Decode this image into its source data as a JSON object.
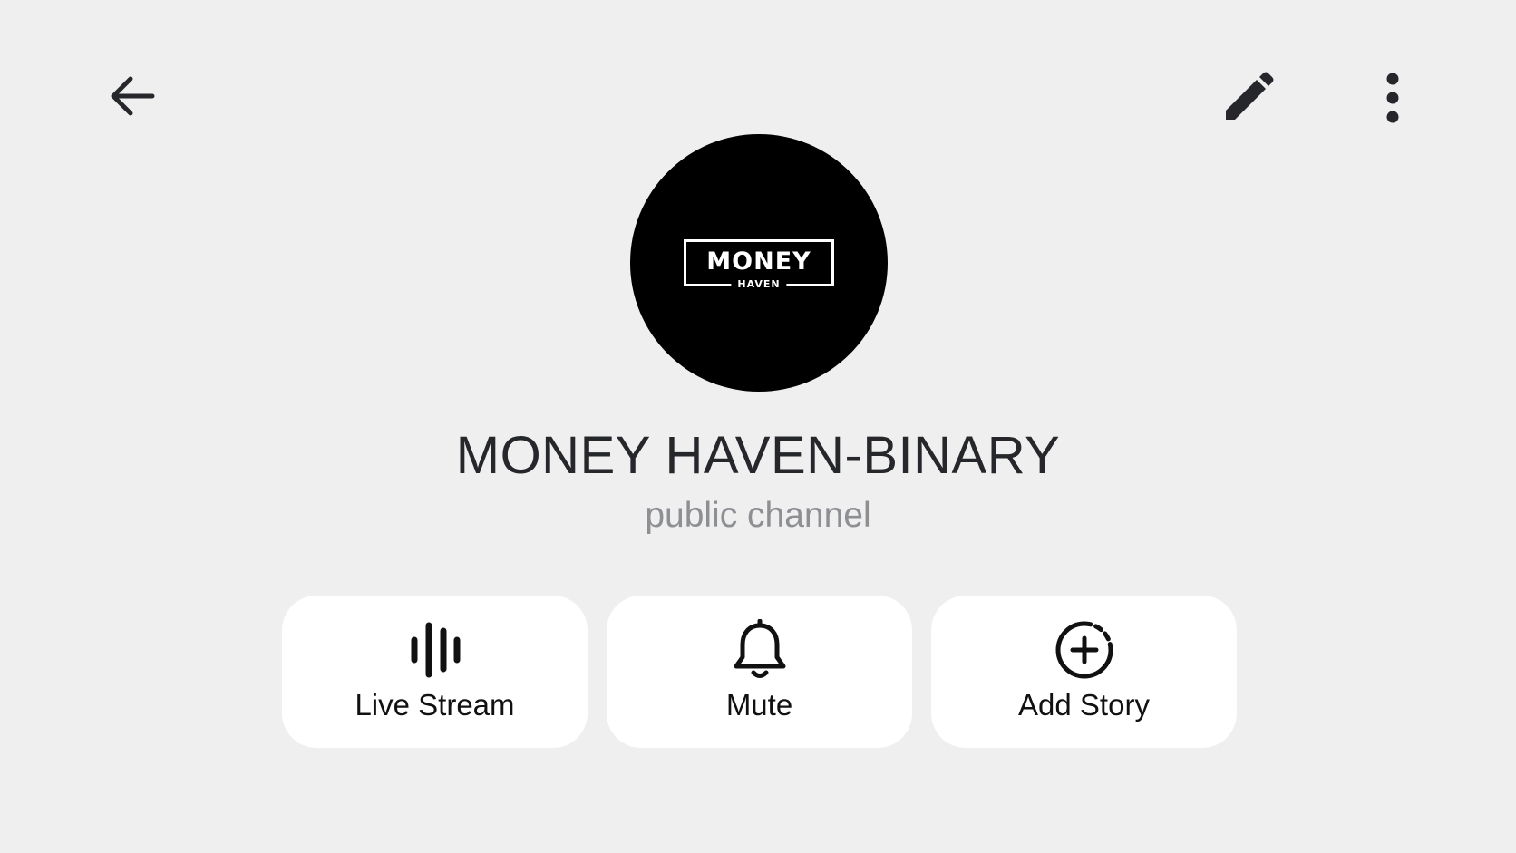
{
  "header": {
    "back_icon": "arrow-left-icon",
    "edit_icon": "pencil-icon",
    "more_icon": "more-vertical-icon"
  },
  "profile": {
    "avatar_logo_main": "MONEY",
    "avatar_logo_sub": "HAVEN",
    "name": "MONEY HAVEN-BINARY",
    "type": "public channel"
  },
  "actions": [
    {
      "label": "Live Stream",
      "icon": "live-stream-icon"
    },
    {
      "label": "Mute",
      "icon": "bell-icon"
    },
    {
      "label": "Add Story",
      "icon": "add-story-icon"
    }
  ],
  "colors": {
    "background": "#efeff0",
    "card": "#ffffff",
    "title_text": "#26272a",
    "subtitle_text": "#8d8f93"
  }
}
